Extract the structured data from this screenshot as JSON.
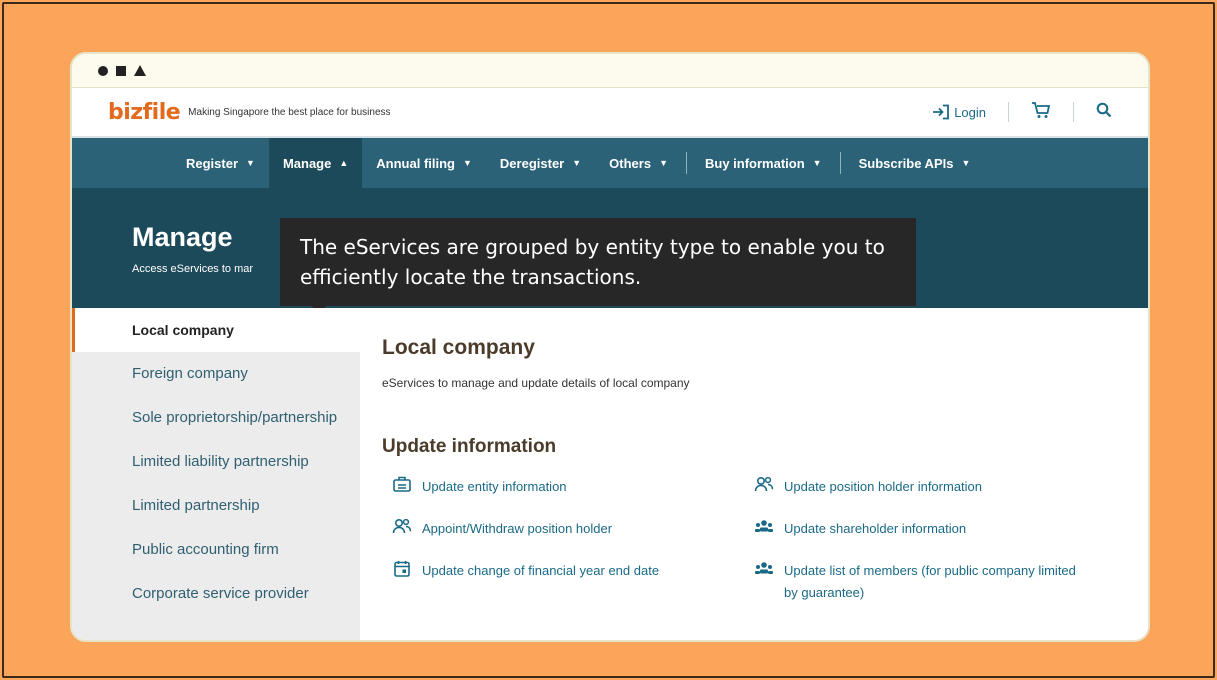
{
  "header": {
    "logo": "bizfile",
    "tagline": "Making Singapore the best place for business",
    "login_label": "Login"
  },
  "nav": [
    {
      "label": "Register"
    },
    {
      "label": "Manage"
    },
    {
      "label": "Annual filing"
    },
    {
      "label": "Deregister"
    },
    {
      "label": "Others"
    },
    {
      "label": "Buy information"
    },
    {
      "label": "Subscribe APIs"
    }
  ],
  "hero": {
    "title": "Manage",
    "subtitle": "Access eServices to mar"
  },
  "tooltip": {
    "text": "The eServices are grouped by entity type to enable you to efficiently locate the transactions."
  },
  "sidebar": [
    {
      "label": "Local company"
    },
    {
      "label": "Foreign company"
    },
    {
      "label": "Sole proprietorship/partnership"
    },
    {
      "label": "Limited liability partnership"
    },
    {
      "label": "Limited partnership"
    },
    {
      "label": "Public accounting firm"
    },
    {
      "label": "Corporate service provider"
    }
  ],
  "main": {
    "title": "Local company",
    "description": "eServices to manage and update details of local company",
    "section_title": "Update information",
    "links": [
      {
        "label": "Update entity information",
        "icon": "building-icon"
      },
      {
        "label": "Update position holder information",
        "icon": "people-icon"
      },
      {
        "label": "Appoint/Withdraw position holder",
        "icon": "people-icon"
      },
      {
        "label": "Update shareholder information",
        "icon": "group-icon"
      },
      {
        "label": "Update change of financial year end date",
        "icon": "calendar-icon"
      },
      {
        "label": "Update list of members (for public company limited by guarantee)",
        "icon": "group-icon"
      }
    ]
  },
  "colors": {
    "background": "#fba55b",
    "nav": "#2b6278",
    "hero": "#1d4a5b",
    "accent": "#e2691d",
    "link": "#1a6a87"
  }
}
